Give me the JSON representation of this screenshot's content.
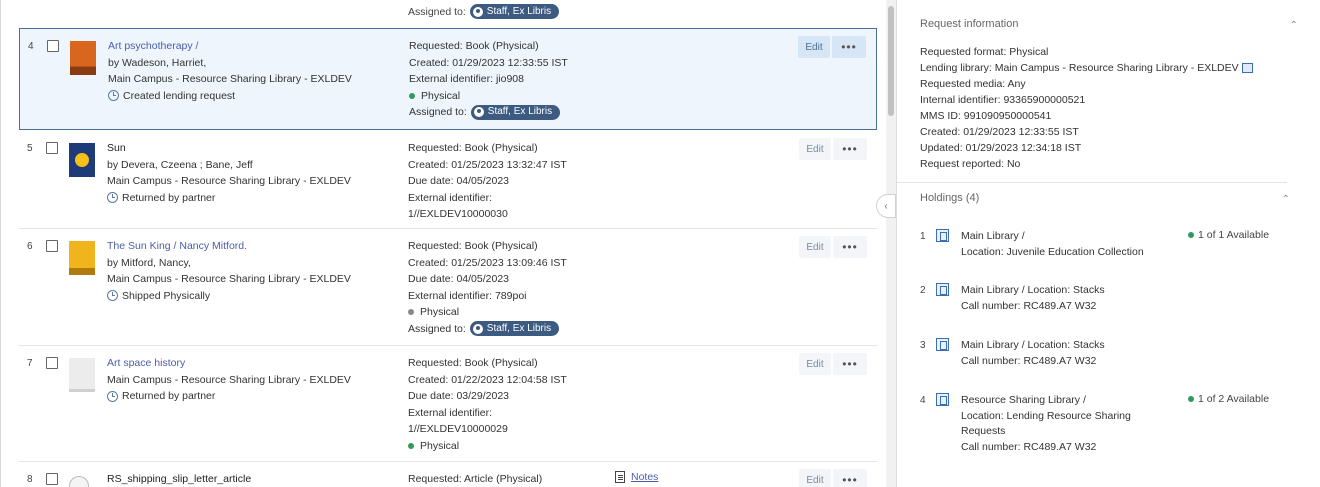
{
  "list": {
    "prev_assigned_label": "Assigned to:",
    "prev_assigned_badge": "Staff, Ex Libris",
    "rows": [
      {
        "num": "4",
        "title": "Art psychotherapy /",
        "author": "by Wadeson, Harriet,",
        "library": "Main Campus - Resource Sharing Library - EXLDEV",
        "status": "Created lending request",
        "requested": "Requested: Book (Physical)",
        "created": "Created: 01/29/2023 12:33:55 IST",
        "ext_id": "External identifier: jio908",
        "format": "Physical",
        "assigned_label": "Assigned to:",
        "assigned_badge": "Staff, Ex Libris"
      },
      {
        "num": "5",
        "title": "Sun",
        "author": "by Devera, Czeena ; Bane, Jeff",
        "library": "Main Campus - Resource Sharing Library - EXLDEV",
        "status": "Returned by partner",
        "requested": "Requested: Book (Physical)",
        "created": "Created: 01/25/2023 13:32:47 IST",
        "due": "Due date: 04/05/2023",
        "ext_id_label": "External identifier:",
        "ext_id_value": "1//EXLDEV10000030"
      },
      {
        "num": "6",
        "title": "The Sun King / Nancy Mitford.",
        "author": "by Mitford, Nancy,",
        "library": "Main Campus - Resource Sharing Library - EXLDEV",
        "status": "Shipped Physically",
        "requested": "Requested: Book (Physical)",
        "created": "Created: 01/25/2023 13:09:46 IST",
        "due": "Due date: 04/05/2023",
        "ext_id": "External identifier: 789poi",
        "format": "Physical",
        "assigned_label": "Assigned to:",
        "assigned_badge": "Staff, Ex Libris"
      },
      {
        "num": "7",
        "title": "Art space history",
        "library": "Main Campus - Resource Sharing Library - EXLDEV",
        "status": "Returned by partner",
        "requested": "Requested: Book (Physical)",
        "created": "Created: 01/22/2023 12:04:58 IST",
        "due": "Due date: 03/29/2023",
        "ext_id_label": "External identifier:",
        "ext_id_value": "1//EXLDEV10000029",
        "format": "Physical"
      },
      {
        "num": "8",
        "title": "RS_shipping_slip_letter_article",
        "requested": "Requested: Article (Physical)",
        "notes": "Notes"
      }
    ],
    "edit_label": "Edit",
    "more_label": "•••"
  },
  "request_info": {
    "heading": "Request information",
    "lines": {
      "format": "Requested format: Physical",
      "lending": "Lending library: Main Campus - Resource Sharing Library - EXLDEV",
      "media": "Requested media: Any",
      "internal": "Internal identifier: 93365900000521",
      "mms": "MMS ID: 991090950000541",
      "created": "Created: 01/29/2023 12:33:55 IST",
      "updated": "Updated: 01/29/2023 12:34:18 IST",
      "reported": "Request reported: No"
    }
  },
  "holdings": {
    "heading": "Holdings (4)",
    "items": [
      {
        "num": "1",
        "line1": "Main Library /",
        "line2": "Location: Juvenile Education Collection",
        "avail": "1 of 1 Available"
      },
      {
        "num": "2",
        "line1": "Main Library / Location: Stacks",
        "line2": "Call number: RC489.A7 W32"
      },
      {
        "num": "3",
        "line1": "Main Library / Location: Stacks",
        "line2": "Call number: RC489.A7 W32"
      },
      {
        "num": "4",
        "line1": "Resource Sharing Library /",
        "line2": "Location: Lending Resource Sharing",
        "line3": "Requests",
        "line4": "Call number: RC489.A7 W32",
        "avail": "1 of 2 Available"
      }
    ]
  },
  "colors": {
    "accent": "#4a5ea8",
    "badge": "#3d5a80",
    "physical_green": "#2e9a5b",
    "physical_gray": "#888888"
  }
}
